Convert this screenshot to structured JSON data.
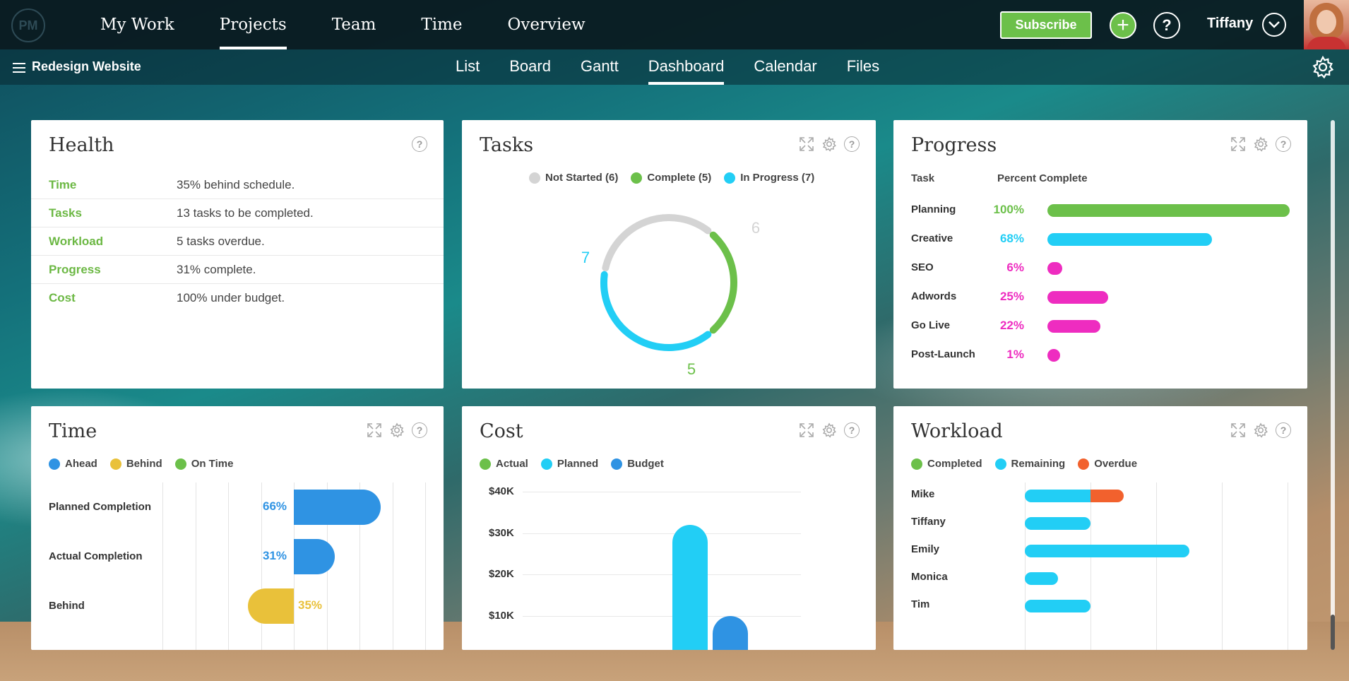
{
  "app": {
    "logo": "PM"
  },
  "topnav": {
    "items": [
      {
        "label": "My Work",
        "active": false
      },
      {
        "label": "Projects",
        "active": true
      },
      {
        "label": "Team",
        "active": false
      },
      {
        "label": "Time",
        "active": false
      },
      {
        "label": "Overview",
        "active": false
      }
    ],
    "subscribe_label": "Subscribe",
    "plus_icon": "plus-icon",
    "help_label": "?",
    "user_name": "Tiffany"
  },
  "subnav": {
    "project_name": "Redesign Website",
    "items": [
      {
        "label": "List",
        "active": false
      },
      {
        "label": "Board",
        "active": false
      },
      {
        "label": "Gantt",
        "active": false
      },
      {
        "label": "Dashboard",
        "active": true
      },
      {
        "label": "Calendar",
        "active": false
      },
      {
        "label": "Files",
        "active": false
      }
    ]
  },
  "colors": {
    "green": "#6cc04a",
    "cyan": "#22cef5",
    "blue": "#2f93e3",
    "yellow": "#e9c13a",
    "magenta": "#ee2cc0",
    "orange": "#f2612d",
    "gray": "#d4d4d4"
  },
  "health": {
    "title": "Health",
    "rows": [
      {
        "label": "Time",
        "text": "35% behind schedule."
      },
      {
        "label": "Tasks",
        "text": "13 tasks to be completed."
      },
      {
        "label": "Workload",
        "text": "5 tasks overdue."
      },
      {
        "label": "Progress",
        "text": "31% complete."
      },
      {
        "label": "Cost",
        "text": "100% under budget."
      }
    ]
  },
  "tasks": {
    "title": "Tasks",
    "legend": [
      {
        "label": "Not Started (6)",
        "color": "#d4d4d4"
      },
      {
        "label": "Complete (5)",
        "color": "#6cc04a"
      },
      {
        "label": "In Progress (7)",
        "color": "#22cef5"
      }
    ],
    "chart_data": {
      "type": "pie",
      "categories": [
        "Not Started",
        "Complete",
        "In Progress"
      ],
      "values": [
        6,
        5,
        7
      ],
      "labels": [
        "6",
        "5",
        "7"
      ]
    }
  },
  "progress": {
    "title": "Progress",
    "col_task": "Task",
    "col_percent": "Percent Complete",
    "chart_data": {
      "type": "bar",
      "categories": [
        "Planning",
        "Creative",
        "SEO",
        "Adwords",
        "Go Live",
        "Post-Launch"
      ],
      "values": [
        100,
        68,
        6,
        25,
        22,
        1
      ],
      "labels": [
        "100%",
        "68%",
        "6%",
        "25%",
        "22%",
        "1%"
      ],
      "colors": [
        "#6cc04a",
        "#22cef5",
        "#ee2cc0",
        "#ee2cc0",
        "#ee2cc0",
        "#ee2cc0"
      ]
    }
  },
  "time": {
    "title": "Time",
    "legend": [
      {
        "label": "Ahead",
        "color": "#2f93e3"
      },
      {
        "label": "Behind",
        "color": "#e9c13a"
      },
      {
        "label": "On Time",
        "color": "#6cc04a"
      }
    ],
    "chart_data": {
      "type": "bar",
      "categories": [
        "Planned Completion",
        "Actual Completion",
        "Behind"
      ],
      "values": [
        66,
        31,
        -35
      ],
      "labels": [
        "66%",
        "31%",
        "35%"
      ],
      "colors": [
        "#2f93e3",
        "#2f93e3",
        "#e9c13a"
      ]
    }
  },
  "cost": {
    "title": "Cost",
    "legend": [
      {
        "label": "Actual",
        "color": "#6cc04a"
      },
      {
        "label": "Planned",
        "color": "#22cef5"
      },
      {
        "label": "Budget",
        "color": "#2f93e3"
      }
    ],
    "chart_data": {
      "type": "bar",
      "series": [
        {
          "name": "Actual",
          "values": [
            0
          ]
        },
        {
          "name": "Planned",
          "values": [
            32000
          ]
        },
        {
          "name": "Budget",
          "values": [
            10000
          ]
        }
      ],
      "yticks": [
        "$40K",
        "$30K",
        "$20K",
        "$10K"
      ],
      "ylim": [
        0,
        40000
      ]
    }
  },
  "workload": {
    "title": "Workload",
    "legend": [
      {
        "label": "Completed",
        "color": "#6cc04a"
      },
      {
        "label": "Remaining",
        "color": "#22cef5"
      },
      {
        "label": "Overdue",
        "color": "#f2612d"
      }
    ],
    "chart_data": {
      "type": "bar",
      "categories": [
        "Mike",
        "Tiffany",
        "Emily",
        "Monica",
        "Tim"
      ],
      "series": [
        {
          "name": "Completed",
          "values": [
            0,
            0,
            0,
            0,
            0
          ]
        },
        {
          "name": "Remaining",
          "values": [
            2,
            2,
            5,
            1,
            2
          ]
        },
        {
          "name": "Overdue",
          "values": [
            1,
            0,
            0,
            0,
            0
          ]
        }
      ]
    }
  }
}
